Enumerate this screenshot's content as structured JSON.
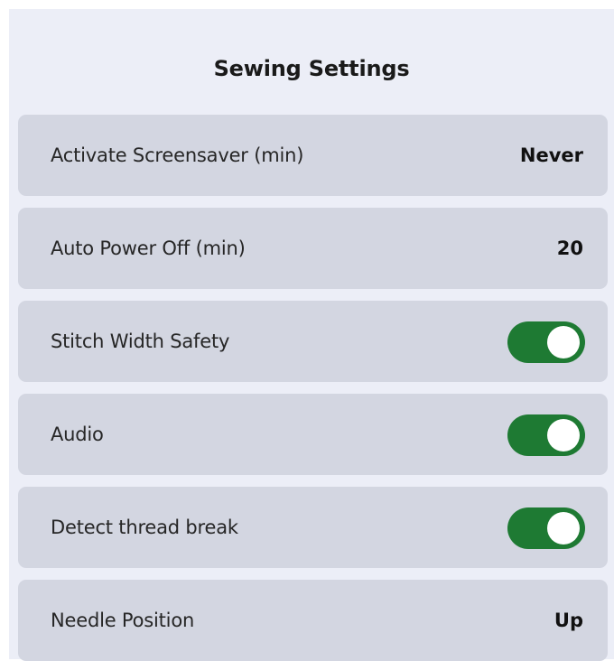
{
  "header": {
    "title": "Sewing Settings"
  },
  "settings": [
    {
      "label": "Activate Screensaver (min)",
      "value": "Never"
    },
    {
      "label": "Auto Power Off (min)",
      "value": "20"
    },
    {
      "label": "Stitch Width Safety",
      "toggle_on": true
    },
    {
      "label": "Audio",
      "toggle_on": true
    },
    {
      "label": "Detect thread break",
      "toggle_on": true
    },
    {
      "label": "Needle Position",
      "value": "Up"
    }
  ],
  "colors": {
    "panel_background": "#eceef7",
    "row_background": "#d3d6e1",
    "toggle_on": "#1e7a33",
    "toggle_knob": "#ffffff"
  }
}
